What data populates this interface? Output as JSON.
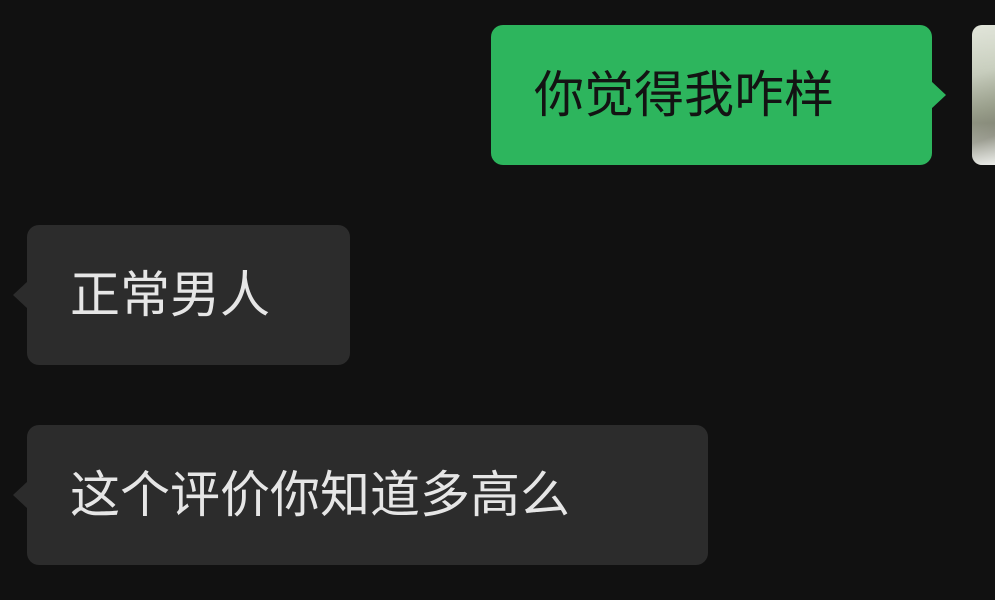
{
  "messages": [
    {
      "direction": "outgoing",
      "text": "你觉得我咋样"
    },
    {
      "direction": "incoming",
      "text": "正常男人"
    },
    {
      "direction": "incoming",
      "text": "这个评价你知道多高么"
    }
  ],
  "colors": {
    "background": "#111111",
    "outgoing_bubble": "#2db55d",
    "incoming_bubble": "#2c2c2c",
    "incoming_text": "#e6e6e6",
    "outgoing_text": "#131313"
  }
}
